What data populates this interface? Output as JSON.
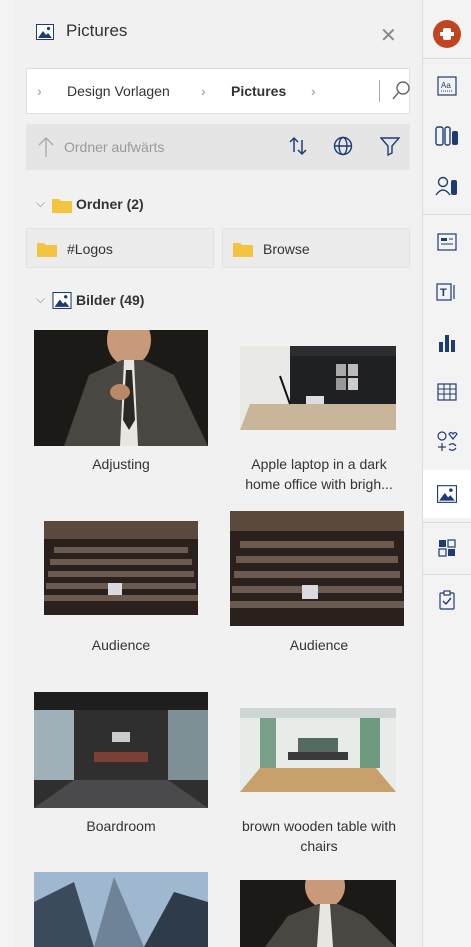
{
  "header": {
    "title": "Pictures",
    "close_icon": "close-icon"
  },
  "breadcrumb": {
    "items": [
      "Design Vorlagen",
      "Pictures"
    ]
  },
  "toolbar": {
    "up_label": "Ordner aufwärts"
  },
  "folders_section": {
    "label": "Ordner (2)",
    "items": [
      "#Logos",
      "Browse"
    ]
  },
  "images_section": {
    "label": "Bilder (49)"
  },
  "images": [
    {
      "caption": "Adjusting"
    },
    {
      "caption_line1": "Apple laptop in a dark",
      "caption_line2": "home office with brigh..."
    },
    {
      "caption": "Audience"
    },
    {
      "caption": "Audience"
    },
    {
      "caption": "Boardroom"
    },
    {
      "caption_line1": "brown wooden table with",
      "caption_line2": "chairs"
    }
  ],
  "colors": {
    "accent": "#c0451f",
    "folder": "#f3c53f",
    "icon_blue": "#1f3b73"
  },
  "rail_icons": [
    "add-in-icon",
    "text-styles-icon",
    "slide-elements-icon",
    "people-icon",
    "agenda-icon",
    "text-box-icon",
    "chart-icon",
    "table-icon",
    "symbols-icon",
    "pictures-icon",
    "layout-icon",
    "checklist-icon"
  ]
}
